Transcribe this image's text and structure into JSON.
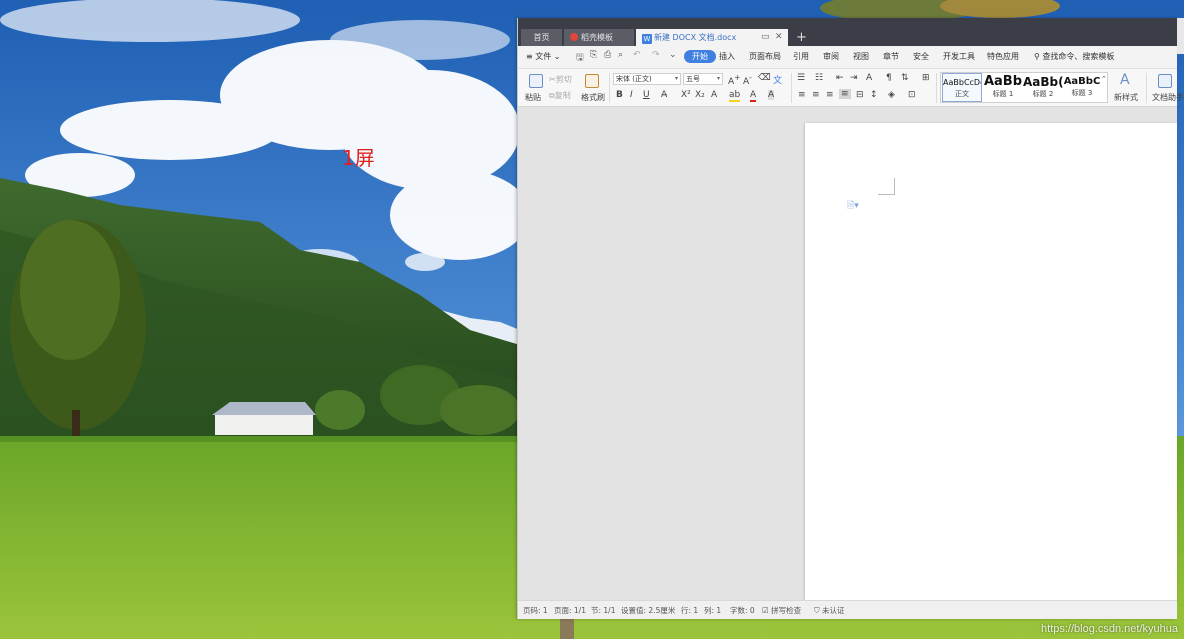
{
  "desktop": {
    "screen_label": "1屏",
    "watermark": "https://blog.csdn.net/kyuhua"
  },
  "wps": {
    "tabs": {
      "home": "首页",
      "template": "稻壳模板",
      "document": "新建 DOCX 文档.docx",
      "add": "+"
    },
    "menu": {
      "file": "文件",
      "items": [
        "开始",
        "插入",
        "页面布局",
        "引用",
        "审阅",
        "视图",
        "章节",
        "安全",
        "开发工具",
        "特色应用"
      ],
      "search": "查找命令、搜索模板"
    },
    "ribbon": {
      "paste": "粘贴",
      "cut": "剪切",
      "copy": "复制",
      "format_painter": "格式刷",
      "font_name": "宋体 (正文)",
      "font_size": "五号",
      "styles": [
        {
          "preview": "AaBbCcDd",
          "name": "正文"
        },
        {
          "preview": "AaBb",
          "name": "标题 1"
        },
        {
          "preview": "AaBb(",
          "name": "标题 2"
        },
        {
          "preview": "AaBbC",
          "name": "标题 3"
        }
      ],
      "new_style": "新样式",
      "doc_helper": "文档助手"
    },
    "status": {
      "page_num": "页码: 1",
      "pages": "页面: 1/1",
      "section": "节: 1/1",
      "setting": "设置值: 2.5厘米",
      "row": "行: 1",
      "col": "列: 1",
      "words": "字数: 0",
      "spell": "拼写检查",
      "auth": "未认证"
    },
    "colors": {
      "accent": "#3f7fe0",
      "tabbar": "#3c3e47"
    }
  }
}
